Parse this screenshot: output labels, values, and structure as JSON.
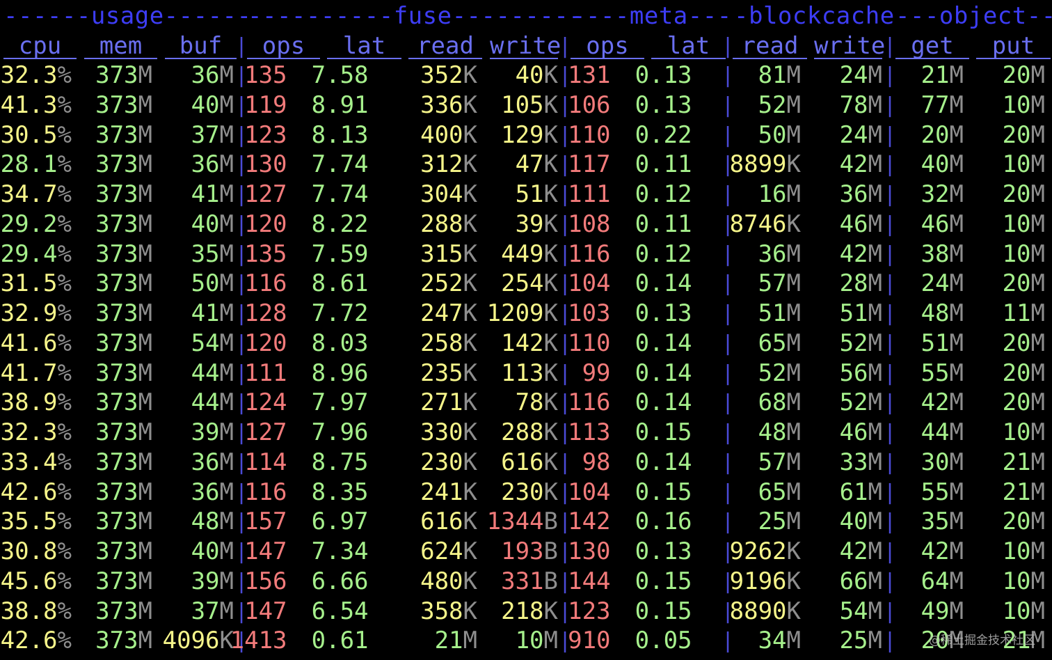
{
  "groups": [
    {
      "key": "usage",
      "text": "------usage------"
    },
    {
      "key": "fuse",
      "text": "----------fuse---------"
    },
    {
      "key": "meta",
      "text": "----meta---"
    },
    {
      "key": "blockcache",
      "text": "-blockcache"
    },
    {
      "key": "object",
      "text": "---object--"
    }
  ],
  "headers": [
    "cpu",
    "mem",
    "buf",
    "ops",
    "lat",
    "read",
    "write",
    "ops",
    "lat",
    "read",
    "write",
    "get",
    "put"
  ],
  "colors": {
    "background": "#000000",
    "group": "#3d3df5",
    "header": "#6a6ff0",
    "yellow": "#f6f58a",
    "green": "#a6f08c",
    "red": "#f27b7b",
    "unit": "#8e8e8e"
  },
  "rows": [
    [
      [
        "32.3",
        "%",
        "yellow"
      ],
      [
        "373",
        "M",
        "green"
      ],
      [
        "36",
        "M",
        "green"
      ],
      [
        "135",
        "",
        "red"
      ],
      [
        "7.58",
        "",
        "green"
      ],
      [
        "352",
        "K",
        "yellow"
      ],
      [
        "40",
        "K",
        "yellow"
      ],
      [
        "131",
        "",
        "red"
      ],
      [
        "0.13",
        "",
        "green"
      ],
      [
        "81",
        "M",
        "green"
      ],
      [
        "24",
        "M",
        "green"
      ],
      [
        "21",
        "M",
        "green"
      ],
      [
        "20",
        "M",
        "green"
      ]
    ],
    [
      [
        "41.3",
        "%",
        "yellow"
      ],
      [
        "373",
        "M",
        "green"
      ],
      [
        "40",
        "M",
        "green"
      ],
      [
        "119",
        "",
        "red"
      ],
      [
        "8.91",
        "",
        "green"
      ],
      [
        "336",
        "K",
        "yellow"
      ],
      [
        "105",
        "K",
        "yellow"
      ],
      [
        "106",
        "",
        "red"
      ],
      [
        "0.13",
        "",
        "green"
      ],
      [
        "52",
        "M",
        "green"
      ],
      [
        "78",
        "M",
        "green"
      ],
      [
        "77",
        "M",
        "green"
      ],
      [
        "10",
        "M",
        "green"
      ]
    ],
    [
      [
        "30.5",
        "%",
        "yellow"
      ],
      [
        "373",
        "M",
        "green"
      ],
      [
        "37",
        "M",
        "green"
      ],
      [
        "123",
        "",
        "red"
      ],
      [
        "8.13",
        "",
        "green"
      ],
      [
        "400",
        "K",
        "yellow"
      ],
      [
        "129",
        "K",
        "yellow"
      ],
      [
        "110",
        "",
        "red"
      ],
      [
        "0.22",
        "",
        "green"
      ],
      [
        "50",
        "M",
        "green"
      ],
      [
        "24",
        "M",
        "green"
      ],
      [
        "20",
        "M",
        "green"
      ],
      [
        "20",
        "M",
        "green"
      ]
    ],
    [
      [
        "28.1",
        "%",
        "green"
      ],
      [
        "373",
        "M",
        "green"
      ],
      [
        "36",
        "M",
        "green"
      ],
      [
        "130",
        "",
        "red"
      ],
      [
        "7.74",
        "",
        "green"
      ],
      [
        "312",
        "K",
        "yellow"
      ],
      [
        "47",
        "K",
        "yellow"
      ],
      [
        "117",
        "",
        "red"
      ],
      [
        "0.11",
        "",
        "green"
      ],
      [
        "8899",
        "K",
        "yellow"
      ],
      [
        "42",
        "M",
        "green"
      ],
      [
        "40",
        "M",
        "green"
      ],
      [
        "10",
        "M",
        "green"
      ]
    ],
    [
      [
        "34.7",
        "%",
        "yellow"
      ],
      [
        "373",
        "M",
        "green"
      ],
      [
        "41",
        "M",
        "green"
      ],
      [
        "127",
        "",
        "red"
      ],
      [
        "7.74",
        "",
        "green"
      ],
      [
        "304",
        "K",
        "yellow"
      ],
      [
        "51",
        "K",
        "yellow"
      ],
      [
        "111",
        "",
        "red"
      ],
      [
        "0.12",
        "",
        "green"
      ],
      [
        "16",
        "M",
        "green"
      ],
      [
        "36",
        "M",
        "green"
      ],
      [
        "32",
        "M",
        "green"
      ],
      [
        "20",
        "M",
        "green"
      ]
    ],
    [
      [
        "29.2",
        "%",
        "green"
      ],
      [
        "373",
        "M",
        "green"
      ],
      [
        "40",
        "M",
        "green"
      ],
      [
        "120",
        "",
        "red"
      ],
      [
        "8.22",
        "",
        "green"
      ],
      [
        "288",
        "K",
        "yellow"
      ],
      [
        "39",
        "K",
        "yellow"
      ],
      [
        "108",
        "",
        "red"
      ],
      [
        "0.11",
        "",
        "green"
      ],
      [
        "8746",
        "K",
        "yellow"
      ],
      [
        "46",
        "M",
        "green"
      ],
      [
        "46",
        "M",
        "green"
      ],
      [
        "10",
        "M",
        "green"
      ]
    ],
    [
      [
        "29.4",
        "%",
        "green"
      ],
      [
        "373",
        "M",
        "green"
      ],
      [
        "35",
        "M",
        "green"
      ],
      [
        "135",
        "",
        "red"
      ],
      [
        "7.59",
        "",
        "green"
      ],
      [
        "315",
        "K",
        "yellow"
      ],
      [
        "449",
        "K",
        "yellow"
      ],
      [
        "116",
        "",
        "red"
      ],
      [
        "0.12",
        "",
        "green"
      ],
      [
        "36",
        "M",
        "green"
      ],
      [
        "42",
        "M",
        "green"
      ],
      [
        "38",
        "M",
        "green"
      ],
      [
        "10",
        "M",
        "green"
      ]
    ],
    [
      [
        "31.5",
        "%",
        "yellow"
      ],
      [
        "373",
        "M",
        "green"
      ],
      [
        "50",
        "M",
        "green"
      ],
      [
        "116",
        "",
        "red"
      ],
      [
        "8.61",
        "",
        "green"
      ],
      [
        "252",
        "K",
        "yellow"
      ],
      [
        "254",
        "K",
        "yellow"
      ],
      [
        "104",
        "",
        "red"
      ],
      [
        "0.14",
        "",
        "green"
      ],
      [
        "57",
        "M",
        "green"
      ],
      [
        "28",
        "M",
        "green"
      ],
      [
        "24",
        "M",
        "green"
      ],
      [
        "20",
        "M",
        "green"
      ]
    ],
    [
      [
        "32.9",
        "%",
        "yellow"
      ],
      [
        "373",
        "M",
        "green"
      ],
      [
        "41",
        "M",
        "green"
      ],
      [
        "128",
        "",
        "red"
      ],
      [
        "7.72",
        "",
        "green"
      ],
      [
        "247",
        "K",
        "yellow"
      ],
      [
        "1209",
        "K",
        "yellow"
      ],
      [
        "103",
        "",
        "red"
      ],
      [
        "0.13",
        "",
        "green"
      ],
      [
        "51",
        "M",
        "green"
      ],
      [
        "51",
        "M",
        "green"
      ],
      [
        "48",
        "M",
        "green"
      ],
      [
        "11",
        "M",
        "green"
      ]
    ],
    [
      [
        "41.6",
        "%",
        "yellow"
      ],
      [
        "373",
        "M",
        "green"
      ],
      [
        "54",
        "M",
        "green"
      ],
      [
        "120",
        "",
        "red"
      ],
      [
        "8.03",
        "",
        "green"
      ],
      [
        "258",
        "K",
        "yellow"
      ],
      [
        "142",
        "K",
        "yellow"
      ],
      [
        "110",
        "",
        "red"
      ],
      [
        "0.14",
        "",
        "green"
      ],
      [
        "65",
        "M",
        "green"
      ],
      [
        "52",
        "M",
        "green"
      ],
      [
        "51",
        "M",
        "green"
      ],
      [
        "20",
        "M",
        "green"
      ]
    ],
    [
      [
        "41.7",
        "%",
        "yellow"
      ],
      [
        "373",
        "M",
        "green"
      ],
      [
        "44",
        "M",
        "green"
      ],
      [
        "111",
        "",
        "red"
      ],
      [
        "8.96",
        "",
        "green"
      ],
      [
        "235",
        "K",
        "yellow"
      ],
      [
        "113",
        "K",
        "yellow"
      ],
      [
        "99",
        "",
        "red"
      ],
      [
        "0.14",
        "",
        "green"
      ],
      [
        "52",
        "M",
        "green"
      ],
      [
        "56",
        "M",
        "green"
      ],
      [
        "55",
        "M",
        "green"
      ],
      [
        "20",
        "M",
        "green"
      ]
    ],
    [
      [
        "38.9",
        "%",
        "yellow"
      ],
      [
        "373",
        "M",
        "green"
      ],
      [
        "44",
        "M",
        "green"
      ],
      [
        "124",
        "",
        "red"
      ],
      [
        "7.97",
        "",
        "green"
      ],
      [
        "271",
        "K",
        "yellow"
      ],
      [
        "78",
        "K",
        "yellow"
      ],
      [
        "116",
        "",
        "red"
      ],
      [
        "0.14",
        "",
        "green"
      ],
      [
        "68",
        "M",
        "green"
      ],
      [
        "52",
        "M",
        "green"
      ],
      [
        "42",
        "M",
        "green"
      ],
      [
        "20",
        "M",
        "green"
      ]
    ],
    [
      [
        "32.3",
        "%",
        "yellow"
      ],
      [
        "373",
        "M",
        "green"
      ],
      [
        "39",
        "M",
        "green"
      ],
      [
        "127",
        "",
        "red"
      ],
      [
        "7.96",
        "",
        "green"
      ],
      [
        "330",
        "K",
        "yellow"
      ],
      [
        "288",
        "K",
        "yellow"
      ],
      [
        "113",
        "",
        "red"
      ],
      [
        "0.15",
        "",
        "green"
      ],
      [
        "48",
        "M",
        "green"
      ],
      [
        "46",
        "M",
        "green"
      ],
      [
        "44",
        "M",
        "green"
      ],
      [
        "10",
        "M",
        "green"
      ]
    ],
    [
      [
        "33.4",
        "%",
        "yellow"
      ],
      [
        "373",
        "M",
        "green"
      ],
      [
        "36",
        "M",
        "green"
      ],
      [
        "114",
        "",
        "red"
      ],
      [
        "8.75",
        "",
        "green"
      ],
      [
        "230",
        "K",
        "yellow"
      ],
      [
        "616",
        "K",
        "yellow"
      ],
      [
        "98",
        "",
        "red"
      ],
      [
        "0.14",
        "",
        "green"
      ],
      [
        "57",
        "M",
        "green"
      ],
      [
        "33",
        "M",
        "green"
      ],
      [
        "30",
        "M",
        "green"
      ],
      [
        "21",
        "M",
        "green"
      ]
    ],
    [
      [
        "42.6",
        "%",
        "yellow"
      ],
      [
        "373",
        "M",
        "green"
      ],
      [
        "36",
        "M",
        "green"
      ],
      [
        "116",
        "",
        "red"
      ],
      [
        "8.35",
        "",
        "green"
      ],
      [
        "241",
        "K",
        "yellow"
      ],
      [
        "230",
        "K",
        "yellow"
      ],
      [
        "104",
        "",
        "red"
      ],
      [
        "0.15",
        "",
        "green"
      ],
      [
        "65",
        "M",
        "green"
      ],
      [
        "61",
        "M",
        "green"
      ],
      [
        "55",
        "M",
        "green"
      ],
      [
        "21",
        "M",
        "green"
      ]
    ],
    [
      [
        "35.5",
        "%",
        "yellow"
      ],
      [
        "373",
        "M",
        "green"
      ],
      [
        "48",
        "M",
        "green"
      ],
      [
        "157",
        "",
        "red"
      ],
      [
        "6.97",
        "",
        "green"
      ],
      [
        "616",
        "K",
        "yellow"
      ],
      [
        "1344",
        "B",
        "red"
      ],
      [
        "142",
        "",
        "red"
      ],
      [
        "0.16",
        "",
        "green"
      ],
      [
        "25",
        "M",
        "green"
      ],
      [
        "40",
        "M",
        "green"
      ],
      [
        "35",
        "M",
        "green"
      ],
      [
        "20",
        "M",
        "green"
      ]
    ],
    [
      [
        "30.8",
        "%",
        "yellow"
      ],
      [
        "373",
        "M",
        "green"
      ],
      [
        "40",
        "M",
        "green"
      ],
      [
        "147",
        "",
        "red"
      ],
      [
        "7.34",
        "",
        "green"
      ],
      [
        "624",
        "K",
        "yellow"
      ],
      [
        "193",
        "B",
        "red"
      ],
      [
        "130",
        "",
        "red"
      ],
      [
        "0.13",
        "",
        "green"
      ],
      [
        "9262",
        "K",
        "yellow"
      ],
      [
        "42",
        "M",
        "green"
      ],
      [
        "42",
        "M",
        "green"
      ],
      [
        "10",
        "M",
        "green"
      ]
    ],
    [
      [
        "45.6",
        "%",
        "yellow"
      ],
      [
        "373",
        "M",
        "green"
      ],
      [
        "39",
        "M",
        "green"
      ],
      [
        "156",
        "",
        "red"
      ],
      [
        "6.66",
        "",
        "green"
      ],
      [
        "480",
        "K",
        "yellow"
      ],
      [
        "331",
        "B",
        "red"
      ],
      [
        "144",
        "",
        "red"
      ],
      [
        "0.15",
        "",
        "green"
      ],
      [
        "9196",
        "K",
        "yellow"
      ],
      [
        "66",
        "M",
        "green"
      ],
      [
        "64",
        "M",
        "green"
      ],
      [
        "10",
        "M",
        "green"
      ]
    ],
    [
      [
        "38.8",
        "%",
        "yellow"
      ],
      [
        "373",
        "M",
        "green"
      ],
      [
        "37",
        "M",
        "green"
      ],
      [
        "147",
        "",
        "red"
      ],
      [
        "6.54",
        "",
        "green"
      ],
      [
        "358",
        "K",
        "yellow"
      ],
      [
        "218",
        "K",
        "yellow"
      ],
      [
        "123",
        "",
        "red"
      ],
      [
        "0.15",
        "",
        "green"
      ],
      [
        "8890",
        "K",
        "yellow"
      ],
      [
        "54",
        "M",
        "green"
      ],
      [
        "49",
        "M",
        "green"
      ],
      [
        "10",
        "M",
        "green"
      ]
    ],
    [
      [
        "42.6",
        "%",
        "yellow"
      ],
      [
        "373",
        "M",
        "green"
      ],
      [
        "4096",
        "K",
        "yellow"
      ],
      [
        "1413",
        "",
        "red"
      ],
      [
        "0.61",
        "",
        "green"
      ],
      [
        "21",
        "M",
        "green"
      ],
      [
        "10",
        "M",
        "green"
      ],
      [
        "910",
        "",
        "red"
      ],
      [
        "0.05",
        "",
        "green"
      ],
      [
        "34",
        "M",
        "green"
      ],
      [
        "25",
        "M",
        "green"
      ],
      [
        "20",
        "M",
        "green"
      ],
      [
        "21",
        "M",
        "green"
      ]
    ]
  ],
  "watermark": "@稀土掘金技术社区"
}
